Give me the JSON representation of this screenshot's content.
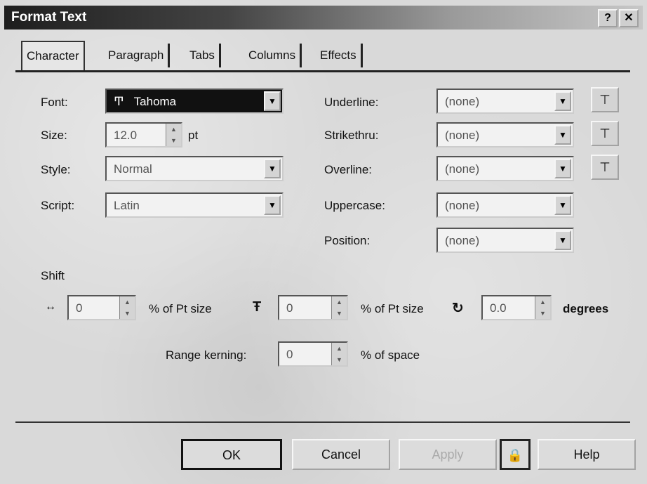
{
  "window": {
    "title": "Format Text",
    "help_glyph": "?",
    "close_glyph": "✕"
  },
  "tabs": [
    "Character",
    "Paragraph",
    "Tabs",
    "Columns",
    "Effects"
  ],
  "character": {
    "font": {
      "label": "Font:",
      "value": "Tahoma",
      "glyph": "Ͳ"
    },
    "size": {
      "label": "Size:",
      "value": "12.0",
      "unit": "pt"
    },
    "style": {
      "label": "Style:",
      "value": "Normal"
    },
    "script": {
      "label": "Script:",
      "value": "Latin"
    },
    "underline": {
      "label": "Underline:",
      "value": "(none)"
    },
    "strikethru": {
      "label": "Strikethru:",
      "value": "(none)"
    },
    "overline": {
      "label": "Overline:",
      "value": "(none)"
    },
    "uppercase": {
      "label": "Uppercase:",
      "value": "(none)"
    },
    "position": {
      "label": "Position:",
      "value": "(none)"
    }
  },
  "shift": {
    "label": "Shift",
    "horizontal": {
      "value": "0",
      "unit": "% of Pt size"
    },
    "vertical": {
      "value": "0",
      "unit": "% of Pt size"
    },
    "rotation": {
      "value": "0.0",
      "unit": "degrees"
    },
    "range_kerning": {
      "label": "Range kerning:",
      "value": "0",
      "unit": "% of space"
    }
  },
  "buttons": {
    "ok": "OK",
    "cancel": "Cancel",
    "apply": "Apply",
    "help": "Help"
  }
}
